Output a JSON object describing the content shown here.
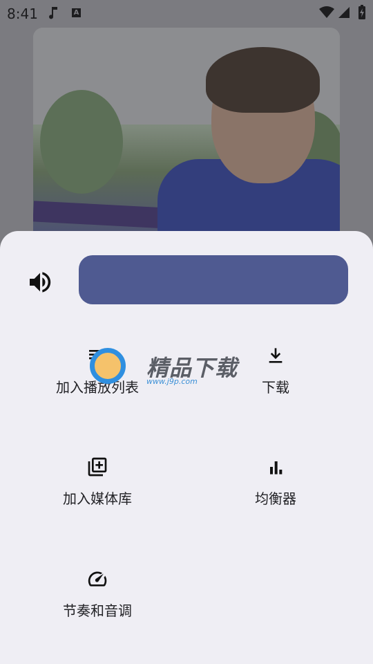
{
  "status_bar": {
    "time": "8:41",
    "icons": [
      "music-note-icon",
      "a-notification-icon",
      "wifi-icon",
      "signal-icon",
      "battery-icon"
    ]
  },
  "album_art": {
    "description_icon": "album-art"
  },
  "volume": {
    "icon": "volume-icon",
    "color": "#4f5a91"
  },
  "actions": [
    {
      "label": "加入播放列表",
      "icon": "playlist-add-icon"
    },
    {
      "label": "下载",
      "icon": "download-icon"
    },
    {
      "label": "加入媒体库",
      "icon": "library-add-icon"
    },
    {
      "label": "均衡器",
      "icon": "equalizer-icon"
    },
    {
      "label": "节奏和音调",
      "icon": "speed-icon"
    }
  ],
  "watermark": {
    "title": "精品下载",
    "url": "www.j9p.com"
  }
}
